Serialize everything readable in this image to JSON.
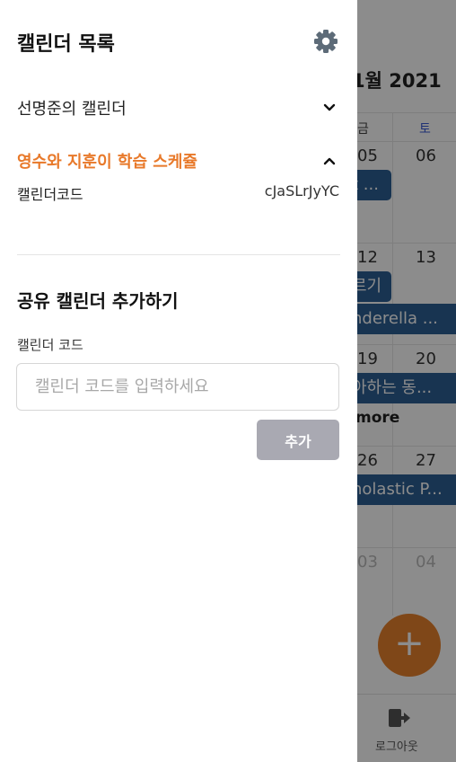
{
  "drawer": {
    "title": "캘린더 목록",
    "calendars": [
      {
        "name": "선명준의 캘린더",
        "expanded": false
      },
      {
        "name": "영수와 지훈이 학습 스케쥴",
        "expanded": true
      }
    ],
    "code_label": "캘린더코드",
    "code_value": "cJaSLrJyYC",
    "add_section": {
      "title": "공유 캘린더 추가하기",
      "field_label": "캘린더 코드",
      "placeholder": "캘린더 코드를 입력하세요",
      "button_label": "추가"
    }
  },
  "background": {
    "month_title": "1월 2021",
    "weekdays": [
      "금",
      "토"
    ],
    "dates": [
      "05",
      "06",
      "12",
      "13",
      "19",
      "20",
      "26",
      "27",
      "03",
      "04"
    ],
    "events": [
      "t ...",
      "르기",
      "nderella ...",
      "아하는 동...",
      "holastic P..."
    ],
    "more_label": "more",
    "fab_label": "+",
    "logout_label": "로그아웃"
  },
  "colors": {
    "accent": "#e8792a",
    "event": "#2c5f94",
    "button_disabled": "#a9a9b2",
    "saturday": "#3b5bd6"
  },
  "icons": [
    "gear-icon",
    "chevron-down-icon",
    "chevron-up-icon",
    "plus-icon",
    "logout-icon"
  ]
}
